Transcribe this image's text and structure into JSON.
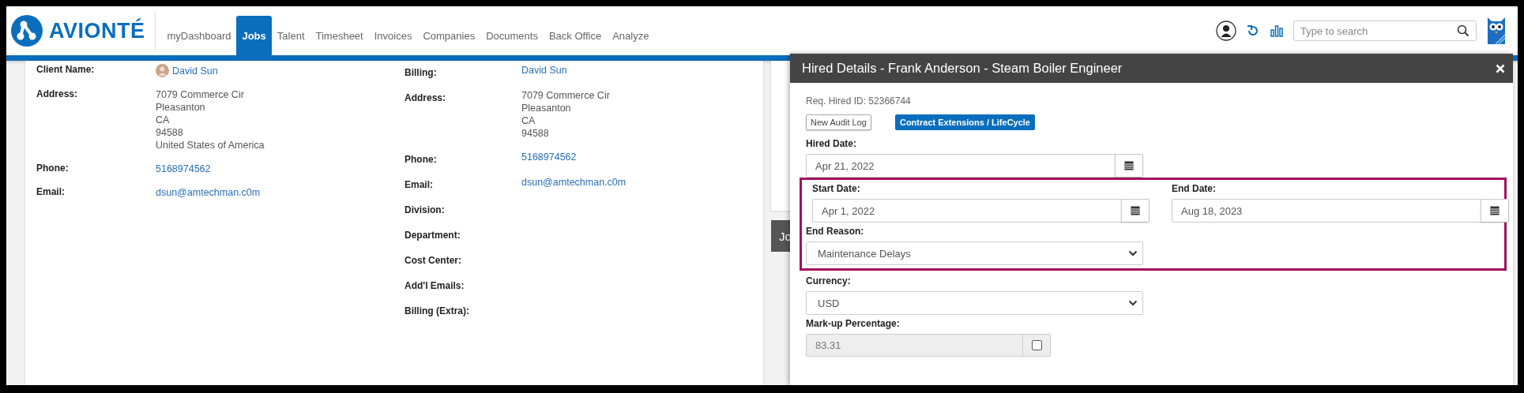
{
  "header": {
    "logo": "AVIONTÉ",
    "nav": [
      {
        "label": "myDashboard",
        "selected": false
      },
      {
        "label": "Jobs",
        "selected": true
      },
      {
        "label": "Talent",
        "selected": false
      },
      {
        "label": "Timesheet",
        "selected": false
      },
      {
        "label": "Invoices",
        "selected": false
      },
      {
        "label": "Companies",
        "selected": false
      },
      {
        "label": "Documents",
        "selected": false
      },
      {
        "label": "Back Office",
        "selected": false
      },
      {
        "label": "Analyze",
        "selected": false
      }
    ],
    "search": {
      "placeholder": "Type to search"
    }
  },
  "client": [
    {
      "label": "Client Name:",
      "kind": "person",
      "lines": [
        "David Sun"
      ]
    },
    {
      "label": "Address:",
      "kind": "text",
      "lines": [
        "7079 Commerce Cir",
        "Pleasanton",
        "CA",
        "94588",
        "United States of America"
      ]
    },
    {
      "label": "Phone:",
      "kind": "link",
      "lines": [
        "5168974562"
      ]
    },
    {
      "label": "Email:",
      "kind": "link",
      "lines": [
        "dsun@amtechman.c0m"
      ]
    }
  ],
  "billing": [
    {
      "label": "Billing:",
      "kind": "link",
      "lines": [
        "David Sun"
      ]
    },
    {
      "label": "Address:",
      "kind": "text",
      "lines": [
        "7079 Commerce Cir",
        "Pleasanton",
        "CA",
        "94588"
      ]
    },
    {
      "label": "Phone:",
      "kind": "link",
      "lines": [
        "5168974562"
      ]
    },
    {
      "label": "Email:",
      "kind": "link",
      "lines": [
        "dsun@amtechman.c0m"
      ]
    },
    {
      "label": "Division:"
    },
    {
      "label": "Department:"
    },
    {
      "label": "Cost Center:"
    },
    {
      "label": "Add'l Emails:"
    },
    {
      "label": "Billing (Extra):"
    }
  ],
  "side_card": {
    "title": "Jo"
  },
  "modal": {
    "title": "Hired Details - Frank Anderson - Steam Boiler Engineer",
    "req_id": "Req. Hired ID: 52366744",
    "buttons": [
      {
        "label": "New Audit Log",
        "kind": "outline"
      },
      {
        "label": "Contract Extensions / LifeCycle",
        "kind": "primary"
      }
    ],
    "hired_date": {
      "label": "Hired Date:",
      "value": "Apr 21, 2022"
    },
    "start_date": {
      "label": "Start Date:",
      "value": "Apr 1, 2022"
    },
    "end_date": {
      "label": "End Date:",
      "value": "Aug 18, 2023"
    },
    "end_reason": {
      "label": "End Reason:",
      "value": "Maintenance Delays"
    },
    "currency": {
      "label": "Currency:",
      "value": "USD"
    },
    "markup": {
      "label": "Mark-up Percentage:",
      "value": "83.31",
      "disabled": true,
      "checked": false
    }
  }
}
